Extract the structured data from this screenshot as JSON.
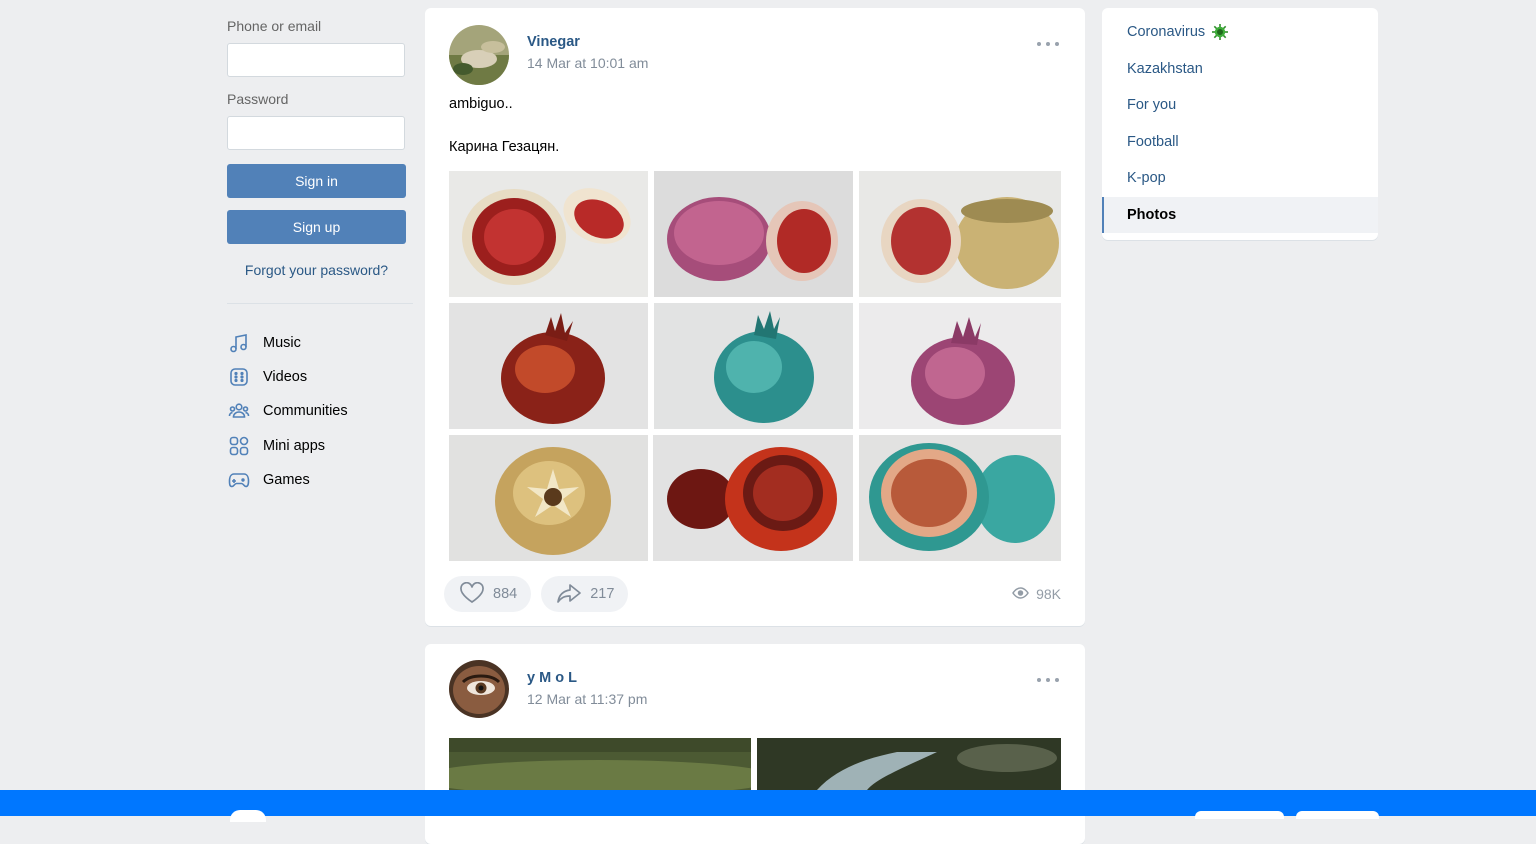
{
  "login": {
    "phone_label": "Phone or email",
    "phone_value": "",
    "password_label": "Password",
    "password_value": "",
    "signin_label": "Sign in",
    "signup_label": "Sign up",
    "forgot_label": "Forgot your password?"
  },
  "menu": [
    {
      "label": "Music",
      "icon": "music-icon"
    },
    {
      "label": "Videos",
      "icon": "video-icon"
    },
    {
      "label": "Communities",
      "icon": "communities-icon"
    },
    {
      "label": "Mini apps",
      "icon": "mini-apps-icon"
    },
    {
      "label": "Games",
      "icon": "gamepad-icon"
    }
  ],
  "posts": [
    {
      "author": "Vinegar",
      "date": "14 Mar at 10:01 am",
      "text": [
        "ambiguo..",
        "Карина Гезацян."
      ],
      "photos": [
        "pomegranate-open-red",
        "pomegranate-pink-halves",
        "pomegranate-cream-halves",
        "pomegranate-dark-red",
        "pomegranate-turquoise",
        "pomegranate-pink",
        "pomegranate-cream-top",
        "pomegranate-red-open",
        "pomegranate-turquoise-open"
      ],
      "likes": "884",
      "shares": "217",
      "views": "98K"
    },
    {
      "author": "y M o L",
      "date": "12 Mar at 11:37 pm",
      "photos": [
        "landscape-hill",
        "landscape-river"
      ]
    }
  ],
  "right_nav": [
    {
      "label": "Coronavirus",
      "active": false
    },
    {
      "label": "Kazakhstan",
      "active": false
    },
    {
      "label": "For you",
      "active": false
    },
    {
      "label": "Football",
      "active": false
    },
    {
      "label": "K-pop",
      "active": false
    },
    {
      "label": "Photos",
      "active": true
    }
  ],
  "colors": {
    "accent": "#5181b8",
    "link": "#2a5885",
    "bottom_bar": "#0077ff",
    "page_bg": "#edeef0"
  }
}
